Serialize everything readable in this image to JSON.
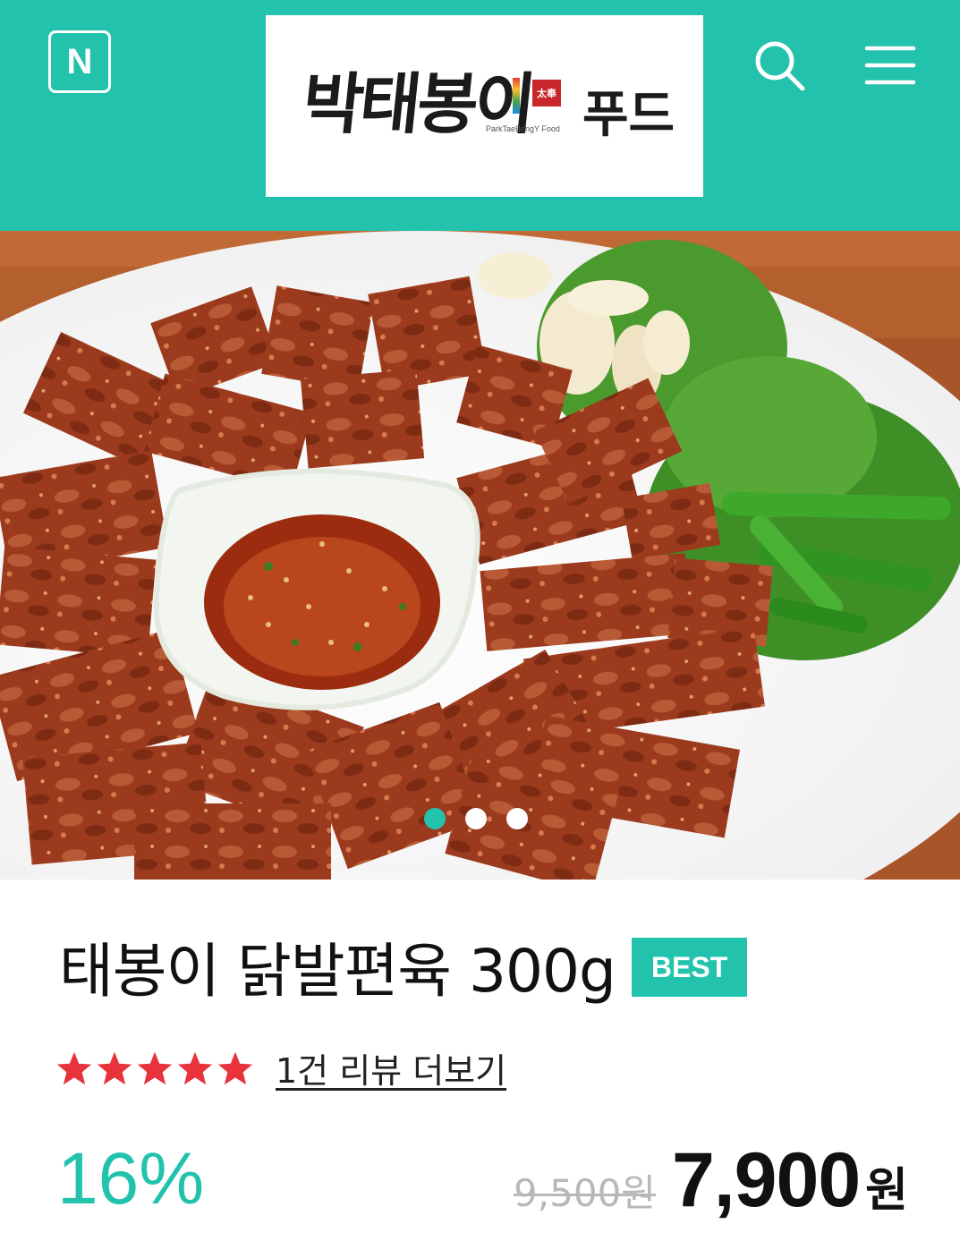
{
  "header": {
    "brand_icon_label": "N",
    "logo": {
      "script_text": "박태봉이",
      "script_text2": "푸드",
      "stamp_text": "太奉",
      "subtitle": "ParkTaeBongY Food"
    },
    "icons": [
      "naver-icon",
      "search-icon",
      "menu-icon"
    ]
  },
  "gallery": {
    "slide_count": 3,
    "active_index": 0
  },
  "product": {
    "title": "태봉이 닭발편육 300g",
    "badge": "BEST",
    "rating": 5,
    "review_link": "1건 리뷰 더보기",
    "discount": "16%",
    "original_price": "9,500원",
    "sale_price": "7,900",
    "currency": "원"
  },
  "colors": {
    "accent": "#22c2ad",
    "star": "#e8323c"
  }
}
